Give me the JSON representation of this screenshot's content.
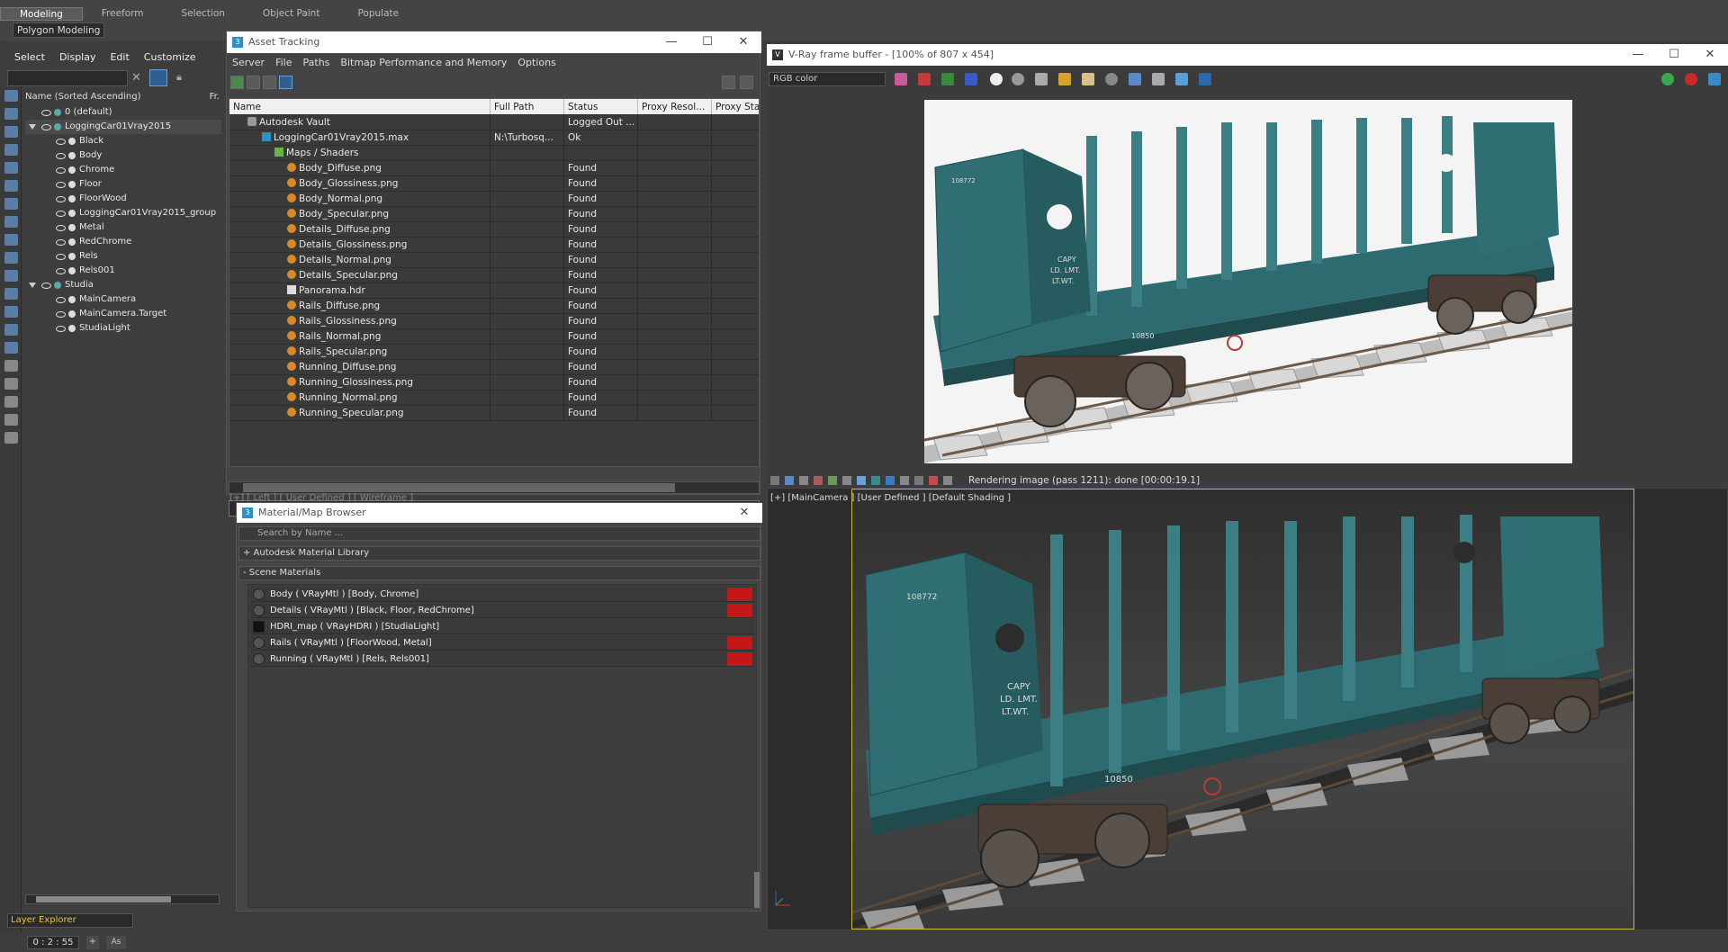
{
  "ribbon": {
    "tabs": [
      "Modeling",
      "Freeform",
      "Selection",
      "Object Paint",
      "Populate"
    ],
    "active_tab": "Modeling",
    "subtab": "Polygon Modeling"
  },
  "scene_explorer": {
    "menu": [
      "Select",
      "Display",
      "Edit",
      "Customize"
    ],
    "column_header": "Name (Sorted Ascending)",
    "column_header_right": "Fr.",
    "rows": [
      {
        "label": "0 (default)",
        "indent": 1
      },
      {
        "label": "LoggingCar01Vray2015",
        "indent": 1
      },
      {
        "label": "Black",
        "indent": 2
      },
      {
        "label": "Body",
        "indent": 2
      },
      {
        "label": "Chrome",
        "indent": 2
      },
      {
        "label": "Floor",
        "indent": 2
      },
      {
        "label": "FloorWood",
        "indent": 2
      },
      {
        "label": "LoggingCar01Vray2015_group",
        "indent": 2
      },
      {
        "label": "Metal",
        "indent": 2
      },
      {
        "label": "RedChrome",
        "indent": 2
      },
      {
        "label": "Rels",
        "indent": 2
      },
      {
        "label": "Rels001",
        "indent": 2
      },
      {
        "label": "Studia",
        "indent": 1
      },
      {
        "label": "MainCamera",
        "indent": 2
      },
      {
        "label": "MainCamera.Target",
        "indent": 2
      },
      {
        "label": "StudiaLight",
        "indent": 2
      }
    ],
    "layer_explorer": "Layer Explorer",
    "time": "0 : 2 : 55",
    "plus_label": "+",
    "as_label": "As"
  },
  "asset_tracking": {
    "title": "Asset Tracking",
    "menu": [
      "Server",
      "File",
      "Paths",
      "Bitmap Performance and Memory",
      "Options"
    ],
    "columns": [
      "Name",
      "Full Path",
      "Status",
      "Proxy Resol...",
      "Proxy Status"
    ],
    "rows": [
      {
        "name": "Autodesk Vault",
        "path": "",
        "status": "Logged Out ...",
        "icon": "vault"
      },
      {
        "name": "LoggingCar01Vray2015.max",
        "path": "N:\\Turbosq...",
        "status": "Ok",
        "icon": "max"
      },
      {
        "name": "Maps / Shaders",
        "path": "",
        "status": "",
        "icon": "maps"
      },
      {
        "name": "Body_Diffuse.png",
        "path": "",
        "status": "Found",
        "icon": "file"
      },
      {
        "name": "Body_Glossiness.png",
        "path": "",
        "status": "Found",
        "icon": "file"
      },
      {
        "name": "Body_Normal.png",
        "path": "",
        "status": "Found",
        "icon": "file"
      },
      {
        "name": "Body_Specular.png",
        "path": "",
        "status": "Found",
        "icon": "file"
      },
      {
        "name": "Details_Diffuse.png",
        "path": "",
        "status": "Found",
        "icon": "file"
      },
      {
        "name": "Details_Glossiness.png",
        "path": "",
        "status": "Found",
        "icon": "file"
      },
      {
        "name": "Details_Normal.png",
        "path": "",
        "status": "Found",
        "icon": "file"
      },
      {
        "name": "Details_Specular.png",
        "path": "",
        "status": "Found",
        "icon": "file"
      },
      {
        "name": "Panorama.hdr",
        "path": "",
        "status": "Found",
        "icon": "hdr"
      },
      {
        "name": "Rails_Diffuse.png",
        "path": "",
        "status": "Found",
        "icon": "file"
      },
      {
        "name": "Rails_Glossiness.png",
        "path": "",
        "status": "Found",
        "icon": "file"
      },
      {
        "name": "Rails_Normal.png",
        "path": "",
        "status": "Found",
        "icon": "file"
      },
      {
        "name": "Rails_Specular.png",
        "path": "",
        "status": "Found",
        "icon": "file"
      },
      {
        "name": "Running_Diffuse.png",
        "path": "",
        "status": "Found",
        "icon": "file"
      },
      {
        "name": "Running_Glossiness.png",
        "path": "",
        "status": "Found",
        "icon": "file"
      },
      {
        "name": "Running_Normal.png",
        "path": "",
        "status": "Found",
        "icon": "file"
      },
      {
        "name": "Running_Specular.png",
        "path": "",
        "status": "Found",
        "icon": "file"
      }
    ]
  },
  "left_viewport_label": "[+] [ Left ] [ User Defined ] [ Wireframe ]",
  "material_browser": {
    "title": "Material/Map Browser",
    "search_placeholder": "Search by Name ...",
    "library_group": "+ Autodesk Material Library",
    "scene_group": "- Scene Materials",
    "materials": [
      {
        "label": "Body  ( VRayMtl ) [Body, Chrome]",
        "flag": true
      },
      {
        "label": "Details  ( VRayMtl ) [Black, Floor, RedChrome]",
        "flag": true
      },
      {
        "label": "HDRI_map  ( VRayHDRI ) [StudiaLight]",
        "flag": false
      },
      {
        "label": "Rails  ( VRayMtl ) [FloorWood, Metal]",
        "flag": true
      },
      {
        "label": "Running  ( VRayMtl ) [Rels, Rels001]",
        "flag": true
      }
    ]
  },
  "vray_frame_buffer": {
    "title": "V-Ray frame buffer - [100% of 807 x 454]",
    "channel": "RGB color",
    "status": "Rendering image (pass 1211): done [00:00:19.1]",
    "car_markings": {
      "number": "108772",
      "capy": "CAPY",
      "line2": "LD. LMT.",
      "line3": "LT.WT.",
      "side_num": "10850"
    }
  },
  "viewport": {
    "label": "[+] [MainCamera ] [User Defined ] [Default Shading ]"
  },
  "colors": {
    "accent": "#2f5f8f",
    "flag_red": "#c41818",
    "car_teal": "#2e6b70",
    "safe_frame": "#c8b93a"
  }
}
